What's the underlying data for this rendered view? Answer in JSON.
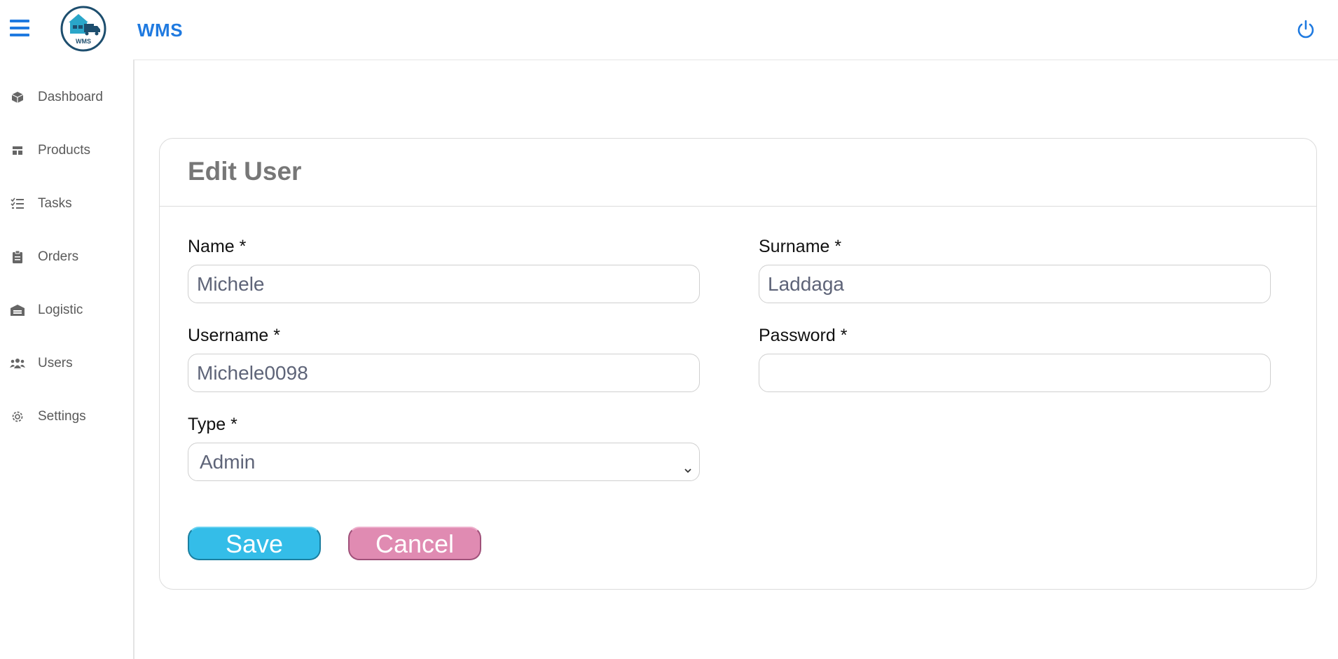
{
  "app": {
    "brand": "WMS",
    "logo_text": "WMS"
  },
  "colors": {
    "accent": "#1f7ae0",
    "save": "#34bde8",
    "cancel": "#e08bb2"
  },
  "sidebar": {
    "items": [
      {
        "label": "Dashboard",
        "icon": "cube-icon"
      },
      {
        "label": "Products",
        "icon": "layout-icon"
      },
      {
        "label": "Tasks",
        "icon": "checklist-icon"
      },
      {
        "label": "Orders",
        "icon": "clipboard-icon"
      },
      {
        "label": "Logistic",
        "icon": "warehouse-icon"
      },
      {
        "label": "Users",
        "icon": "users-icon"
      },
      {
        "label": "Settings",
        "icon": "gear-icon"
      }
    ]
  },
  "form": {
    "title": "Edit User",
    "name": {
      "label": "Name *",
      "value": "Michele"
    },
    "surname": {
      "label": "Surname *",
      "value": "Laddaga"
    },
    "username": {
      "label": "Username *",
      "value": "Michele0098"
    },
    "password": {
      "label": "Password *",
      "value": ""
    },
    "type": {
      "label": "Type *",
      "value": "Admin"
    },
    "save_label": "Save",
    "cancel_label": "Cancel"
  }
}
